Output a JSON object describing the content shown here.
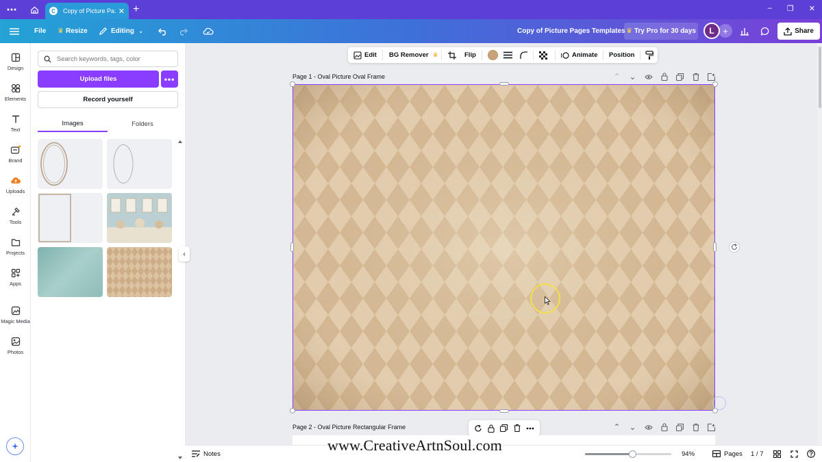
{
  "browser": {
    "tab_title": "Copy of Picture Pa...",
    "tab_favicon": "C",
    "new_tab": "+",
    "window_controls": [
      "–",
      "❐",
      "✕"
    ]
  },
  "header": {
    "file": "File",
    "resize": "Resize",
    "editing": "Editing",
    "doc_title": "Copy of Picture Pages Templates",
    "try_pro": "Try Pro for 30 days",
    "avatar_initial": "L",
    "share": "Share"
  },
  "rail": {
    "items": [
      {
        "label": "Design",
        "icon": "design-icon"
      },
      {
        "label": "Elements",
        "icon": "elements-icon"
      },
      {
        "label": "Text",
        "icon": "text-icon"
      },
      {
        "label": "Brand",
        "icon": "brand-icon"
      },
      {
        "label": "Uploads",
        "icon": "uploads-icon"
      },
      {
        "label": "Tools",
        "icon": "tools-icon"
      },
      {
        "label": "Projects",
        "icon": "projects-icon"
      },
      {
        "label": "Apps",
        "icon": "apps-icon"
      },
      {
        "label": "Magic Media",
        "icon": "magic-media-icon"
      },
      {
        "label": "Photos",
        "icon": "photos-icon"
      }
    ]
  },
  "panel": {
    "search_placeholder": "Search keywords, tags, color",
    "upload": "Upload files",
    "more": "•••",
    "record": "Record yourself",
    "tabs": [
      "Images",
      "Folders"
    ]
  },
  "context_toolbar": {
    "edit": "Edit",
    "bg_remover": "BG Remover",
    "flip": "Flip",
    "color": "#c9a47a",
    "animate": "Animate",
    "position": "Position"
  },
  "canvas": {
    "page1_title": "Page 1 - Oval Picture Oval Frame",
    "page2_title": "Page 2 - Oval Picture Rectangular Frame"
  },
  "footer": {
    "notes": "Notes",
    "zoom_value": "94%",
    "zoom_fraction": 0.55,
    "pages": "Pages",
    "page_count": "1 / 7"
  },
  "watermark": "www.CreativeArtnSoul.com",
  "colors": {
    "accent": "#8b3dff",
    "header_start": "#23a3d6",
    "header_end": "#7a3fd8",
    "paper": "#d8bf9b"
  }
}
